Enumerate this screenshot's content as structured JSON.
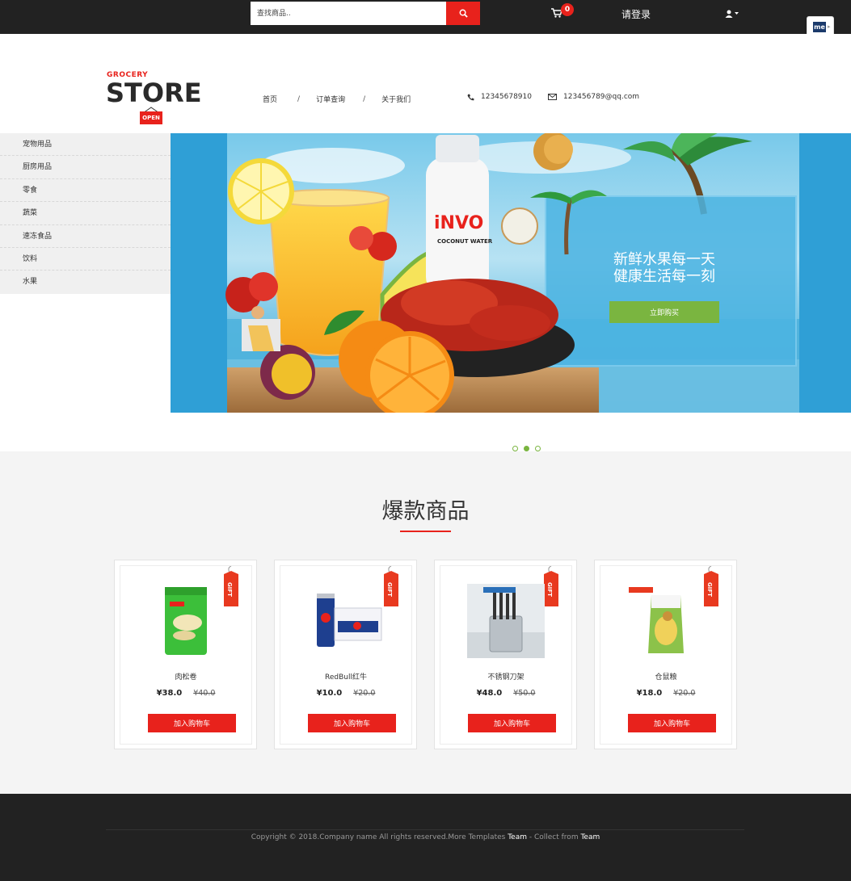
{
  "topbar": {
    "search_placeholder": "查找商品..",
    "cart_count": "0",
    "login_label": "请登录"
  },
  "logo": {
    "small": "GROCERY",
    "big": "STORE",
    "sign": "OPEN"
  },
  "nav": {
    "items": [
      "首页",
      "订单查询",
      "关于我们"
    ],
    "separator": "/",
    "phone": "12345678910",
    "email": "123456789@qq.com"
  },
  "sidebar": {
    "items": [
      "宠物用品",
      "厨房用品",
      "零食",
      "蔬菜",
      "速冻食品",
      "饮料",
      "水果"
    ]
  },
  "banner": {
    "slogan_line1": "新鲜水果每一天",
    "slogan_line2": "健康生活每一刻",
    "button": "立即购买",
    "bottle_brand": "iNVO",
    "bottle_sub": "COCONUT WATER",
    "slides_total": 3,
    "active_slide": 2
  },
  "hot": {
    "title": "爆款商品",
    "gift_tag": "GIFT",
    "add_to_cart": "加入购物车",
    "products": [
      {
        "name": "肉松卷",
        "price": "¥38.0",
        "old_price": "¥40.0",
        "icon": "snack-bag"
      },
      {
        "name": "RedBull红牛",
        "price": "¥10.0",
        "old_price": "¥20.0",
        "icon": "energy-drink"
      },
      {
        "name": "不锈钢刀架",
        "price": "¥48.0",
        "old_price": "¥50.0",
        "icon": "knife-rack"
      },
      {
        "name": "仓鼠粮",
        "price": "¥18.0",
        "old_price": "¥20.0",
        "icon": "hamster-food"
      }
    ]
  },
  "footer": {
    "copyright": "Copyright © 2018.Company name All rights reserved.More Templates",
    "team1": "Team",
    "dash": " - Collect from ",
    "team2": "Team"
  },
  "colors": {
    "accent": "#e8221c",
    "green": "#7ab540",
    "dark": "#222222"
  }
}
